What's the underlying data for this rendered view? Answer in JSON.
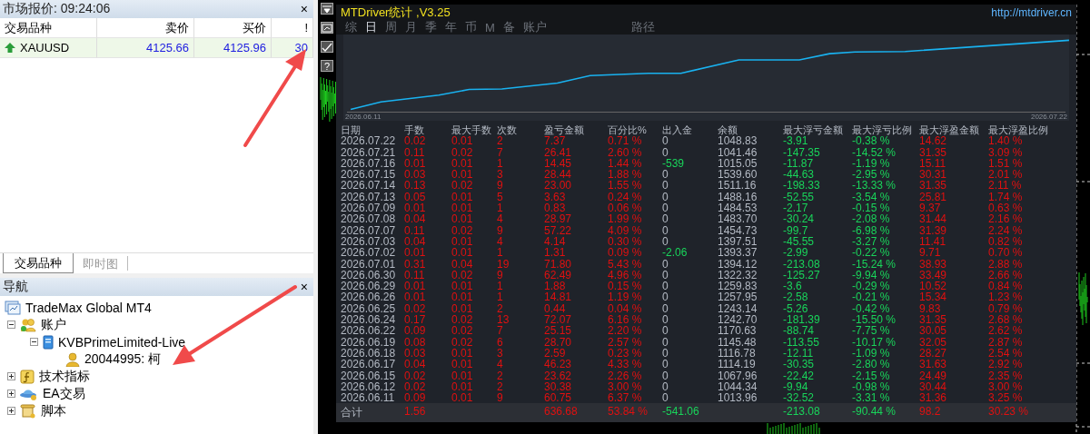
{
  "market_watch": {
    "title": "市场报价: 09:24:06",
    "close": "×",
    "columns": [
      "交易品种",
      "卖价",
      "买价",
      "!"
    ],
    "rows": [
      {
        "symbol": "XAUUSD",
        "bid": "4125.66",
        "ask": "4125.96",
        "spread": "30",
        "kind": "up"
      }
    ]
  },
  "tabs": [
    {
      "label": "交易品种",
      "selected": true
    },
    {
      "label": "即时图",
      "selected": false
    }
  ],
  "navigator": {
    "title": "导航",
    "close": "×",
    "tree": [
      {
        "label": "TradeMax Global MT4",
        "kind": "terminal"
      },
      {
        "label": "账户",
        "kind": "accounts",
        "expanded": true,
        "children": [
          {
            "label": "KVBPrimeLimited-Live",
            "kind": "server",
            "expanded": true,
            "children": [
              {
                "label": "20044995: 柯",
                "kind": "user"
              }
            ]
          }
        ]
      },
      {
        "label": "技术指标",
        "kind": "indicator",
        "expanded": false
      },
      {
        "label": "EA交易",
        "kind": "expert",
        "expanded": false
      },
      {
        "label": "脚本",
        "kind": "script",
        "expanded": false
      }
    ]
  },
  "toolbar": [
    {
      "kind": "dropdown"
    },
    {
      "kind": "chart"
    },
    {
      "kind": "check"
    },
    {
      "kind": "help",
      "label": "?"
    }
  ],
  "stats": {
    "title": "MTDriver统计 ,V3.25",
    "link": "http://mtdriver.cn",
    "periods": [
      {
        "label": "综",
        "selected": false
      },
      {
        "label": "日",
        "selected": true
      },
      {
        "label": "周",
        "selected": false
      },
      {
        "label": "月",
        "selected": false
      },
      {
        "label": "季",
        "selected": false
      },
      {
        "label": "年",
        "selected": false
      },
      {
        "label": "币",
        "selected": false
      },
      {
        "label": "M",
        "selected": false
      },
      {
        "label": "备",
        "selected": false
      },
      {
        "label": "账户",
        "selected": false
      }
    ],
    "path_label": "路径",
    "chart": {
      "start": "2026.06.11",
      "end": "2026.07.22"
    },
    "columns": [
      "日期",
      "手数",
      "最大手数",
      "次数",
      "盈亏金额",
      "百分比%",
      "出入金",
      "余额",
      "最大浮亏金额",
      "最大浮亏比例",
      "最大浮盈金额",
      "最大浮盈比例"
    ],
    "rows": [
      {
        "flow": false,
        "cells": [
          "2026.07.22",
          "0.02",
          "0.01",
          "2",
          "7.37",
          "0.71 %",
          "0",
          "1048.83",
          "-3.91",
          "-0.38 %",
          "14.62",
          "1.40 %"
        ]
      },
      {
        "flow": false,
        "cells": [
          "2026.07.21",
          "0.11",
          "0.02",
          "7",
          "26.41",
          "2.60 %",
          "0",
          "1041.46",
          "-147.35",
          "-14.52 %",
          "31.35",
          "3.09 %"
        ]
      },
      {
        "flow": true,
        "cells": [
          "2026.07.16",
          "0.01",
          "0.01",
          "1",
          "14.45",
          "1.44 %",
          "-539",
          "1015.05",
          "-11.87",
          "-1.19 %",
          "15.11",
          "1.51 %"
        ]
      },
      {
        "flow": false,
        "cells": [
          "2026.07.15",
          "0.03",
          "0.01",
          "3",
          "28.44",
          "1.88 %",
          "0",
          "1539.60",
          "-44.63",
          "-2.95 %",
          "30.31",
          "2.01 %"
        ]
      },
      {
        "flow": false,
        "cells": [
          "2026.07.14",
          "0.13",
          "0.02",
          "9",
          "23.00",
          "1.55 %",
          "0",
          "1511.16",
          "-198.33",
          "-13.33 %",
          "31.35",
          "2.11 %"
        ]
      },
      {
        "flow": false,
        "cells": [
          "2026.07.13",
          "0.05",
          "0.01",
          "5",
          "3.63",
          "0.24 %",
          "0",
          "1488.16",
          "-52.55",
          "-3.54 %",
          "25.81",
          "1.74 %"
        ]
      },
      {
        "flow": false,
        "cells": [
          "2026.07.09",
          "0.01",
          "0.01",
          "1",
          "0.83",
          "0.06 %",
          "0",
          "1484.53",
          "-2.17",
          "-0.15 %",
          "9.37",
          "0.63 %"
        ]
      },
      {
        "flow": false,
        "cells": [
          "2026.07.08",
          "0.04",
          "0.01",
          "4",
          "28.97",
          "1.99 %",
          "0",
          "1483.70",
          "-30.24",
          "-2.08 %",
          "31.44",
          "2.16 %"
        ]
      },
      {
        "flow": false,
        "cells": [
          "2026.07.07",
          "0.11",
          "0.02",
          "9",
          "57.22",
          "4.09 %",
          "0",
          "1454.73",
          "-99.7",
          "-6.98 %",
          "31.39",
          "2.24 %"
        ]
      },
      {
        "flow": false,
        "cells": [
          "2026.07.03",
          "0.04",
          "0.01",
          "4",
          "4.14",
          "0.30 %",
          "0",
          "1397.51",
          "-45.55",
          "-3.27 %",
          "11.41",
          "0.82 %"
        ]
      },
      {
        "flow": true,
        "cells": [
          "2026.07.02",
          "0.01",
          "0.01",
          "1",
          "1.31",
          "0.09 %",
          "-2.06",
          "1393.37",
          "-2.99",
          "-0.22 %",
          "9.71",
          "0.70 %"
        ]
      },
      {
        "flow": false,
        "cells": [
          "2026.07.01",
          "0.31",
          "0.04",
          "19",
          "71.80",
          "5.43 %",
          "0",
          "1394.12",
          "-213.08",
          "-15.24 %",
          "38.93",
          "2.88 %"
        ]
      },
      {
        "flow": false,
        "cells": [
          "2026.06.30",
          "0.11",
          "0.02",
          "9",
          "62.49",
          "4.96 %",
          "0",
          "1322.32",
          "-125.27",
          "-9.94 %",
          "33.49",
          "2.66 %"
        ]
      },
      {
        "flow": false,
        "cells": [
          "2026.06.29",
          "0.01",
          "0.01",
          "1",
          "1.88",
          "0.15 %",
          "0",
          "1259.83",
          "-3.6",
          "-0.29 %",
          "10.52",
          "0.84 %"
        ]
      },
      {
        "flow": false,
        "cells": [
          "2026.06.26",
          "0.01",
          "0.01",
          "1",
          "14.81",
          "1.19 %",
          "0",
          "1257.95",
          "-2.58",
          "-0.21 %",
          "15.34",
          "1.23 %"
        ]
      },
      {
        "flow": false,
        "cells": [
          "2026.06.25",
          "0.02",
          "0.01",
          "2",
          "0.44",
          "0.04 %",
          "0",
          "1243.14",
          "-5.26",
          "-0.42 %",
          "9.83",
          "0.79 %"
        ]
      },
      {
        "flow": false,
        "cells": [
          "2026.06.24",
          "0.17",
          "0.02",
          "13",
          "72.07",
          "6.16 %",
          "0",
          "1242.70",
          "-181.39",
          "-15.50 %",
          "31.35",
          "2.68 %"
        ]
      },
      {
        "flow": false,
        "cells": [
          "2026.06.22",
          "0.09",
          "0.02",
          "7",
          "25.15",
          "2.20 %",
          "0",
          "1170.63",
          "-88.74",
          "-7.75 %",
          "30.05",
          "2.62 %"
        ]
      },
      {
        "flow": false,
        "cells": [
          "2026.06.19",
          "0.08",
          "0.02",
          "6",
          "28.70",
          "2.57 %",
          "0",
          "1145.48",
          "-113.55",
          "-10.17 %",
          "32.05",
          "2.87 %"
        ]
      },
      {
        "flow": false,
        "cells": [
          "2026.06.18",
          "0.03",
          "0.01",
          "3",
          "2.59",
          "0.23 %",
          "0",
          "1116.78",
          "-12.11",
          "-1.09 %",
          "28.27",
          "2.54 %"
        ]
      },
      {
        "flow": false,
        "cells": [
          "2026.06.17",
          "0.04",
          "0.01",
          "4",
          "46.23",
          "4.33 %",
          "0",
          "1114.19",
          "-30.35",
          "-2.80 %",
          "31.63",
          "2.92 %"
        ]
      },
      {
        "flow": false,
        "cells": [
          "2026.06.15",
          "0.02",
          "0.01",
          "2",
          "23.62",
          "2.26 %",
          "0",
          "1067.96",
          "-22.42",
          "-2.15 %",
          "24.49",
          "2.35 %"
        ]
      },
      {
        "flow": false,
        "cells": [
          "2026.06.12",
          "0.02",
          "0.01",
          "2",
          "30.38",
          "3.00 %",
          "0",
          "1044.34",
          "-9.94",
          "-0.98 %",
          "30.44",
          "3.00 %"
        ]
      },
      {
        "flow": false,
        "cells": [
          "2026.06.11",
          "0.09",
          "0.01",
          "9",
          "60.75",
          "6.37 %",
          "0",
          "1013.96",
          "-32.52",
          "-3.31 %",
          "31.36",
          "3.25 %"
        ]
      }
    ],
    "total": {
      "label": "合计",
      "cells": [
        "1.56",
        "",
        "",
        "636.68",
        "53.84 %",
        "-541.06",
        "",
        "-213.08",
        "-90.44 %",
        "98.2",
        "30.23 %"
      ]
    }
  }
}
